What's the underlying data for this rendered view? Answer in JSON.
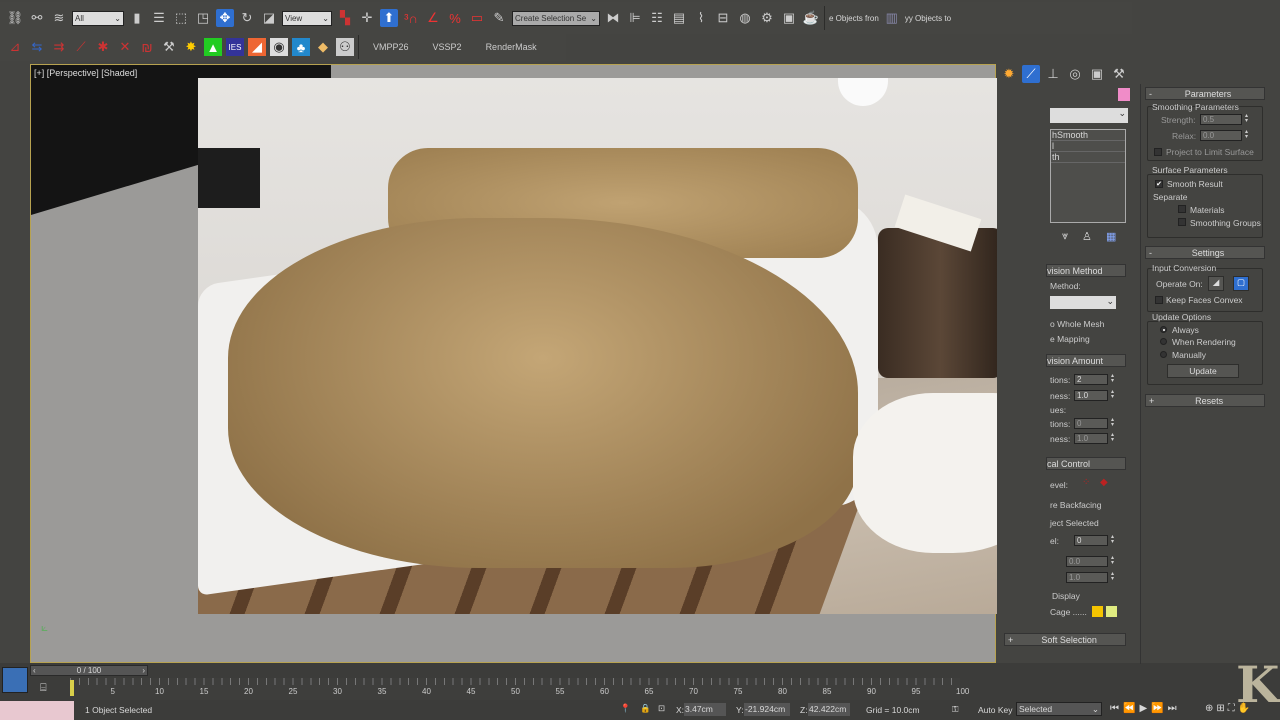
{
  "toolbar1": {
    "selection_filter": "All",
    "reference_coord": "View",
    "named_selection": "Create Selection Se",
    "tail_text_1": "e Objects fron",
    "tail_text_2": "yy Objects to",
    "icons": [
      "link-icon",
      "unlink-icon",
      "bind-space-warp-icon",
      "select-object-icon",
      "select-by-name-icon",
      "rect-selection-icon",
      "window-crossing-icon",
      "select-move-icon",
      "select-rotate-icon",
      "select-scale-icon",
      "pivot-icon",
      "manipulate-icon",
      "keyboard-shortcut-icon",
      "snap-3d-icon",
      "angle-snap-icon",
      "percent-snap-icon",
      "spinner-snap-icon",
      "edit-named-selection-icon",
      "mirror-icon",
      "align-icon",
      "layer-manager-icon",
      "scene-explorer-icon",
      "curve-editor-icon",
      "schematic-view-icon",
      "material-editor-icon",
      "render-setup-icon",
      "rendered-frame-icon",
      "render-icon"
    ]
  },
  "toolbar2": {
    "icons": [
      "tool-1-icon",
      "tool-2-icon",
      "tool-3-icon",
      "tool-4-icon",
      "tool-5-icon",
      "tool-6-icon",
      "tool-7-icon",
      "hammer-icon",
      "light-icon",
      "green-tool-icon",
      "ies-icon",
      "orange-tool-icon",
      "camera-tool-icon",
      "tree-icon",
      "paint-icon",
      "render-mask-icon"
    ],
    "tabs": [
      "VMPP26",
      "VSSP2",
      "RenderMask"
    ]
  },
  "viewport": {
    "label": "[+] [Perspective] [Shaded]"
  },
  "command_panel": {
    "tabs": [
      "create-icon",
      "modify-icon",
      "hierarchy-icon",
      "motion-icon",
      "display-icon",
      "utilities-icon"
    ],
    "modifier_stack": [
      "hSmooth",
      "l",
      "th"
    ],
    "left_col": {
      "subdivision_method": "vision Method",
      "method_label": "Method:",
      "whole_mesh": "o Whole Mesh",
      "mapping": "e Mapping",
      "subdivision_amount": "vision Amount",
      "iterations_label": "tions:",
      "iterations": "2",
      "smoothness_label": "ness:",
      "smoothness": "1.0",
      "values_label": "ues:",
      "render_iter_label": "tions:",
      "render_iter": "0",
      "render_smooth_label": "ness:",
      "render_smooth": "1.0",
      "local_control": "cal Control",
      "level_label": "evel:",
      "ignore_backfacing": "re Backfacing",
      "object_selected": "ject Selected",
      "control_level_label": "el:",
      "control_level": "0",
      "crease": "0.0",
      "weight": "1.0",
      "display": "Display",
      "cage": "Cage ......",
      "cage_colors": [
        "#f5c400",
        "#e0ec80"
      ],
      "soft_selection": "Soft Selection"
    },
    "parameters": {
      "title": "Parameters",
      "smoothing_params": "Smoothing Parameters",
      "strength_label": "Strength:",
      "strength": "0.5",
      "relax_label": "Relax:",
      "relax": "0.0",
      "project_limit": "Project to Limit Surface",
      "surface_params": "Surface Parameters",
      "smooth_result": "Smooth Result",
      "separate": "Separate",
      "materials": "Materials",
      "smoothing_groups": "Smoothing Groups"
    },
    "settings": {
      "title": "Settings",
      "input_conversion": "Input Conversion",
      "operate_on": "Operate On:",
      "keep_convex": "Keep Faces Convex",
      "update_options": "Update Options",
      "always": "Always",
      "when_rendering": "When Rendering",
      "manually": "Manually",
      "update": "Update"
    },
    "resets": "Resets"
  },
  "timeline": {
    "frame": "0 / 100",
    "ticks": [
      "5",
      "10",
      "15",
      "20",
      "25",
      "30",
      "35",
      "40",
      "45",
      "50",
      "55",
      "60",
      "65",
      "70",
      "75",
      "80",
      "85",
      "90",
      "95",
      "100"
    ]
  },
  "status": {
    "selected": "1 Object Selected",
    "x_label": "X:",
    "x": "3.47cm",
    "y_label": "Y:",
    "y": "-21.924cm",
    "z_label": "Z:",
    "z": "42.422cm",
    "grid": "Grid = 10.0cm",
    "auto_key": "Auto Key",
    "key_filter": "Selected"
  },
  "accent": "#2f6fd0",
  "object_color": "#f08cc8"
}
